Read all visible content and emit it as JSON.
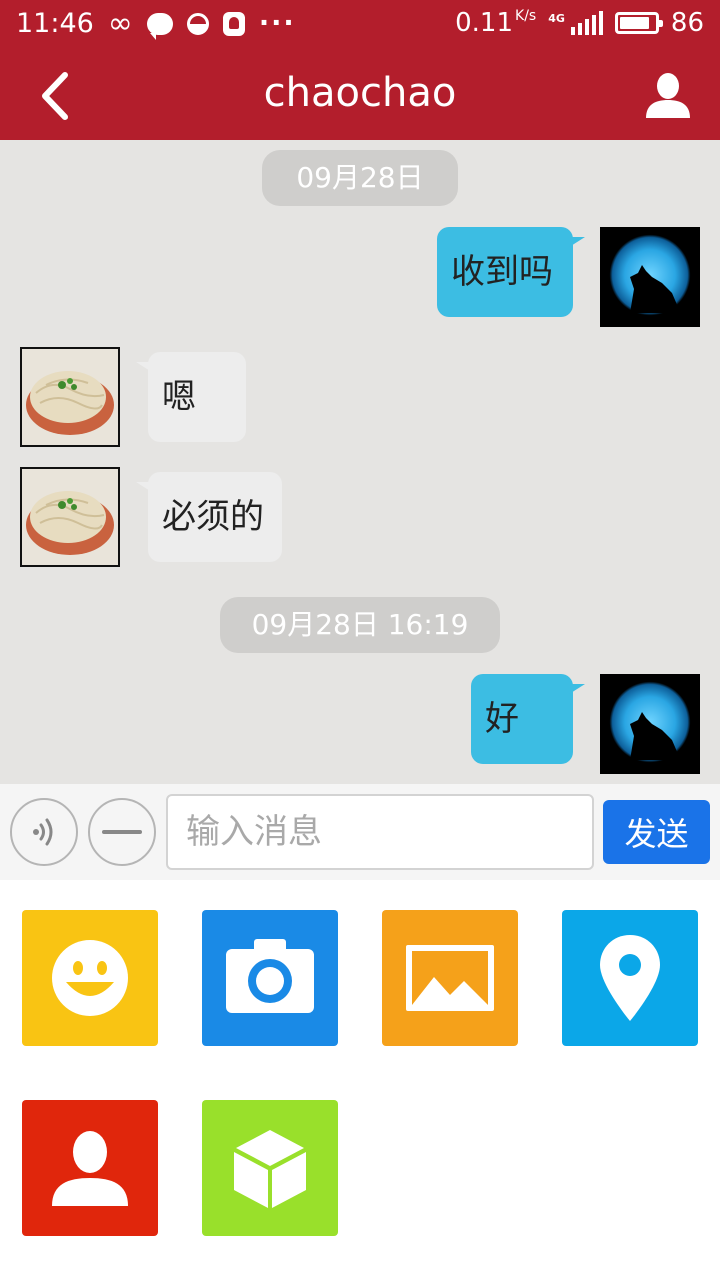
{
  "status_bar": {
    "time": "11:46",
    "net_speed": "0.11",
    "net_unit": "K/s",
    "network": "4G",
    "battery": "86"
  },
  "header": {
    "title": "chaochao",
    "accent_color": "#b31e2c"
  },
  "messages": [
    {
      "type": "time",
      "text": "09月28日"
    },
    {
      "type": "sent",
      "text": "收到吗"
    },
    {
      "type": "received",
      "text": "嗯"
    },
    {
      "type": "received",
      "text": "必须的"
    },
    {
      "type": "time",
      "text": "09月28日 16:19"
    },
    {
      "type": "sent",
      "text": "好"
    }
  ],
  "input_bar": {
    "voice_icon": "voice-icon",
    "emoji_toggle_icon": "minus-icon",
    "placeholder": "输入消息",
    "send_label": "发送"
  },
  "panel": {
    "tiles": [
      {
        "icon": "emoji-icon",
        "color": "#f9c413"
      },
      {
        "icon": "camera-icon",
        "color": "#1a8ae6"
      },
      {
        "icon": "image-icon",
        "color": "#f5a11a"
      },
      {
        "icon": "location-icon",
        "color": "#0ba7e8"
      },
      {
        "icon": "contact-icon",
        "color": "#e0260c"
      },
      {
        "icon": "cube-icon",
        "color": "#99e02b"
      }
    ]
  }
}
